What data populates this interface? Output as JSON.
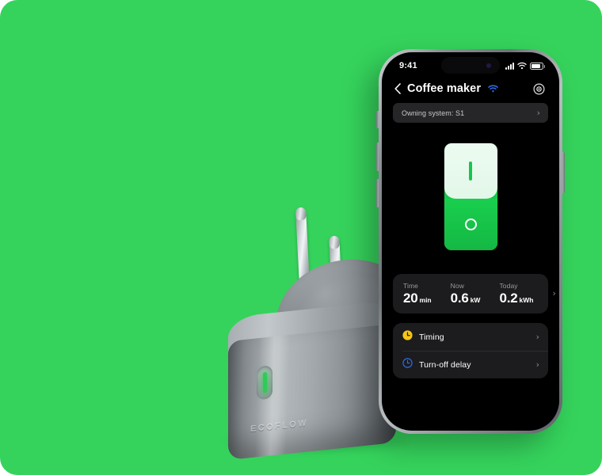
{
  "background": {
    "color": "#35D35C"
  },
  "device": {
    "brand": "ECOFLOW",
    "led_color": "#2ecc56",
    "name": "smart-plug"
  },
  "phone": {
    "status_bar": {
      "time": "9:41",
      "icons": [
        "cellular-signal-icon",
        "wifi-icon",
        "battery-icon"
      ]
    },
    "nav": {
      "back_icon": "chevron-left-icon",
      "title": "Coffee maker",
      "connection_icon": "wifi-icon",
      "connection_color": "#2D6BE5",
      "right_icon": "power-settings-icon"
    },
    "owning_system": {
      "label": "Owning system: S1",
      "chevron": "›"
    },
    "power_switch": {
      "state": "on",
      "on_mark": "I",
      "off_mark": "O",
      "on_color": "#17C64A",
      "top_color": "#ecfbf0"
    },
    "stats": {
      "chevron": "›",
      "items": [
        {
          "label": "Time",
          "value": "20",
          "unit": "min"
        },
        {
          "label": "Now",
          "value": "0.6",
          "unit": "kW"
        },
        {
          "label": "Today",
          "value": "0.2",
          "unit": "kWh"
        }
      ]
    },
    "actions": [
      {
        "label": "Timing",
        "icon": "clock-filled-icon",
        "icon_color": "#F5C518",
        "chevron": "›"
      },
      {
        "label": "Turn-off delay",
        "icon": "clock-outline-icon",
        "icon_color": "#2D6BE5",
        "chevron": "›"
      }
    ]
  }
}
